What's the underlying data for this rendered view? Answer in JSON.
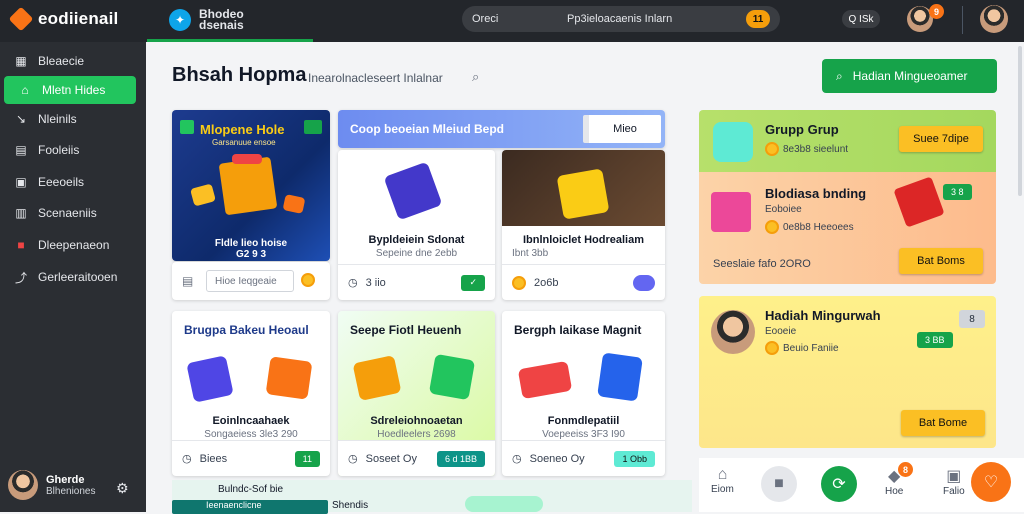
{
  "topbar": {
    "logo_text": "eodiienail",
    "app_tab_text": "Bhodeo dsenais",
    "search_left": "Oreci",
    "search_right": "Pp3ieloacaenis Inlarn",
    "search_badge": "11",
    "pill_text": "Q ISk",
    "notif_count": "9"
  },
  "sidebar": {
    "items": [
      {
        "icon": "grid-icon",
        "glyph": "▦",
        "label": "Bleaecie"
      },
      {
        "icon": "home-icon",
        "glyph": "⌂",
        "label": "Mletn Hides"
      },
      {
        "icon": "arrow-icon",
        "glyph": "↘",
        "label": "Nleinils"
      },
      {
        "icon": "table-icon",
        "glyph": "▤",
        "label": "Fooleiis"
      },
      {
        "icon": "calendar-icon",
        "glyph": "▣",
        "label": "Eeeoeils"
      },
      {
        "icon": "report-icon",
        "glyph": "▥",
        "label": "Scenaeniis"
      },
      {
        "icon": "gift-icon",
        "glyph": "■",
        "label": "Dleepenaeon"
      },
      {
        "icon": "share-icon",
        "glyph": "⤴",
        "label": "Gerleeraitooen"
      }
    ],
    "user_name": "Gherde",
    "user_sub": "Blheniones"
  },
  "header": {
    "title": "Bhsah Hopma",
    "subtitle": "Inearolnacleseert Inlalnar",
    "cta_label": "Hadian Mingueoamer"
  },
  "cards": {
    "promo": {
      "title": "Mlopene Hole",
      "subtitle": "Garsanuue ensoe",
      "footer": "Fldle lieo hoise\nG2 9 3"
    },
    "banner": {
      "text": "Coop beoeian Mleiud Bepd",
      "button": "Mieo"
    },
    "c2": {
      "title": "Bypldeiein Sdonat",
      "sub": "Sepeine dne 2ebb",
      "foot": "3 iio"
    },
    "c3": {
      "title": "Ibnlnloiclet Hodrealiam",
      "sub": "Ibnt 3bb",
      "foot": "2o6b"
    },
    "c4": {
      "title": "Brugpa Bakeu Heoaul",
      "sub": "Eoinlncaahaek",
      "sub2": "Songaeiess 3le3 290",
      "foot": "Biees",
      "badge": "11"
    },
    "c5": {
      "title": "Seepe Fiotl Heuenh",
      "sub": "Sdreleiohnoaetan",
      "sub2": "Hoedleelers 2698",
      "foot": "Soseet Oy",
      "badge": "6 d 1BB"
    },
    "c6": {
      "title": "Bergph Iaikase Magnit",
      "sub": "Fonmdlepatiil",
      "sub2": "Voepeeiss 3F3 I90",
      "foot": "Soeneo Oy",
      "badge": "1 Obb"
    }
  },
  "right": {
    "top_title": "Grupp Grup",
    "top_sub": "8e3b8 sieelunt",
    "top_btn": "Suee 7dipe",
    "mid_title": "Blodiasa bnding",
    "mid_sub": "Eoboiee",
    "mid_sub2": "0e8b8 Heeoees",
    "mid_badge": "3 8",
    "mid_note": "Seeslaie fafo 2ORO",
    "mid_btn": "Bat Boms",
    "low_title": "Hadiah Mingurwah",
    "low_sub": "Eooeie",
    "low_sub2": "Beuio Faniie",
    "low_badge": "8",
    "low_gbadge": "3 BB",
    "low_btn": "Bat Bome"
  },
  "bottom_nav": {
    "items": [
      {
        "label": "Eiom"
      },
      {
        "label": ""
      },
      {
        "label": ""
      },
      {
        "label": "Hoe"
      },
      {
        "label": "Falio"
      }
    ],
    "notif": "8"
  },
  "strip": {
    "text": "Bulndc-Sof bie",
    "left_btn": "Ieenaenclicne",
    "right_text": "Shendis"
  }
}
